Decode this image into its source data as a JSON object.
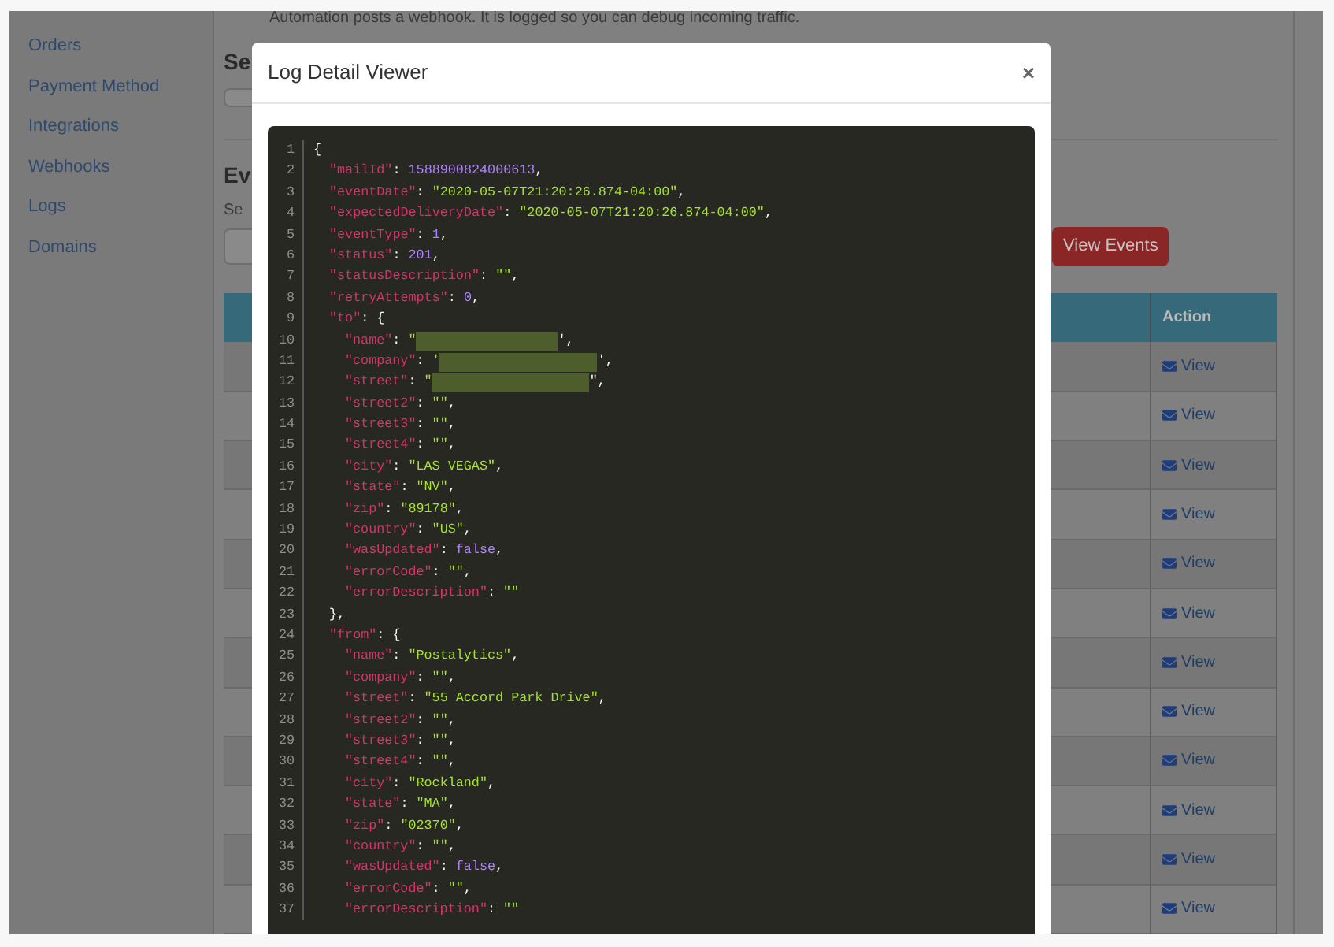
{
  "sidebar": {
    "items": [
      {
        "label": "Orders"
      },
      {
        "label": "Payment Method"
      },
      {
        "label": "Integrations"
      },
      {
        "label": "Webhooks"
      },
      {
        "label": "Logs"
      },
      {
        "label": "Domains"
      }
    ]
  },
  "intro_text": "Automation posts a webhook. It is logged so you can debug incoming traffic.",
  "section_1": {
    "heading": "Se"
  },
  "section_2": {
    "heading": "Ev",
    "label": "Se",
    "button": "View Events"
  },
  "table": {
    "columns": [
      {
        "label": "Action"
      }
    ],
    "rows": [
      {
        "action": "View"
      },
      {
        "action": "View"
      },
      {
        "action": "View"
      },
      {
        "action": "View"
      },
      {
        "action": "View"
      },
      {
        "action": "View"
      },
      {
        "action": "View"
      },
      {
        "action": "View"
      },
      {
        "action": "View"
      },
      {
        "action": "View"
      },
      {
        "action": "View"
      },
      {
        "action": "View"
      }
    ]
  },
  "modal": {
    "title": "Log Detail Viewer",
    "close": "×",
    "lines": [
      {
        "n": "1",
        "value": "{",
        "kind": "punct",
        "children": [
          {
            "n": "2",
            "key": "\"mailId\"",
            "sep": ": ",
            "value": "1588900824000613",
            "kind": "number",
            "end": ","
          },
          {
            "n": "3",
            "key": "\"eventDate\"",
            "sep": ": ",
            "value": "\"2020-05-07T21:20:26.874-04:00\"",
            "kind": "string",
            "end": ","
          },
          {
            "n": "4",
            "key": "\"expectedDeliveryDate\"",
            "sep": ": ",
            "value": "\"2020-05-07T21:20:26.874-04:00\"",
            "kind": "string",
            "end": ","
          },
          {
            "n": "5",
            "key": "\"eventType\"",
            "sep": ": ",
            "value": "1",
            "kind": "number",
            "end": ","
          },
          {
            "n": "6",
            "key": "\"status\"",
            "sep": ": ",
            "value": "201",
            "kind": "number",
            "end": ","
          },
          {
            "n": "7",
            "key": "\"statusDescription\"",
            "sep": ": ",
            "value": "\"\"",
            "kind": "string",
            "end": ","
          },
          {
            "n": "8",
            "key": "\"retryAttempts\"",
            "sep": ": ",
            "value": "0",
            "kind": "number",
            "end": ","
          },
          {
            "n": "9",
            "key": "\"to\"",
            "sep": ": ",
            "value": "{",
            "kind": "punct",
            "children": [
              {
                "n": "10",
                "key": "\"name\"",
                "sep": ": ",
                "value": "\"",
                "kind": "redacted",
                "end": "',"
              },
              {
                "n": "11",
                "key": "\"company\"",
                "sep": ": ",
                "value": "'",
                "kind": "redacted",
                "end": "',"
              },
              {
                "n": "12",
                "key": "\"street\"",
                "sep": ": ",
                "value": "\"",
                "kind": "redacted",
                "end": "\","
              },
              {
                "n": "13",
                "key": "\"street2\"",
                "sep": ": ",
                "value": "\"\"",
                "kind": "string",
                "end": ","
              },
              {
                "n": "14",
                "key": "\"street3\"",
                "sep": ": ",
                "value": "\"\"",
                "kind": "string",
                "end": ","
              },
              {
                "n": "15",
                "key": "\"street4\"",
                "sep": ": ",
                "value": "\"\"",
                "kind": "string",
                "end": ","
              },
              {
                "n": "16",
                "key": "\"city\"",
                "sep": ": ",
                "value": "\"LAS VEGAS\"",
                "kind": "string",
                "end": ","
              },
              {
                "n": "17",
                "key": "\"state\"",
                "sep": ": ",
                "value": "\"NV\"",
                "kind": "string",
                "end": ","
              },
              {
                "n": "18",
                "key": "\"zip\"",
                "sep": ": ",
                "value": "\"89178\"",
                "kind": "string",
                "end": ","
              },
              {
                "n": "19",
                "key": "\"country\"",
                "sep": ": ",
                "value": "\"US\"",
                "kind": "string",
                "end": ","
              },
              {
                "n": "20",
                "key": "\"wasUpdated\"",
                "sep": ": ",
                "value": "false",
                "kind": "number",
                "end": ","
              },
              {
                "n": "21",
                "key": "\"errorCode\"",
                "sep": ": ",
                "value": "\"\"",
                "kind": "string",
                "end": ","
              },
              {
                "n": "22",
                "key": "\"errorDescription\"",
                "sep": ": ",
                "value": "\"\"",
                "kind": "string"
              }
            ]
          },
          {
            "n": "23",
            "value": "},",
            "kind": "punct"
          },
          {
            "n": "24",
            "key": "\"from\"",
            "sep": ": ",
            "value": "{",
            "kind": "punct",
            "children": [
              {
                "n": "25",
                "key": "\"name\"",
                "sep": ": ",
                "value": "\"Postalytics\"",
                "kind": "string",
                "end": ","
              },
              {
                "n": "26",
                "key": "\"company\"",
                "sep": ": ",
                "value": "\"\"",
                "kind": "string",
                "end": ","
              },
              {
                "n": "27",
                "key": "\"street\"",
                "sep": ": ",
                "value": "\"55 Accord Park Drive\"",
                "kind": "string",
                "end": ","
              },
              {
                "n": "28",
                "key": "\"street2\"",
                "sep": ": ",
                "value": "\"\"",
                "kind": "string",
                "end": ","
              },
              {
                "n": "29",
                "key": "\"street3\"",
                "sep": ": ",
                "value": "\"\"",
                "kind": "string",
                "end": ","
              },
              {
                "n": "30",
                "key": "\"street4\"",
                "sep": ": ",
                "value": "\"\"",
                "kind": "string",
                "end": ","
              },
              {
                "n": "31",
                "key": "\"city\"",
                "sep": ": ",
                "value": "\"Rockland\"",
                "kind": "string",
                "end": ","
              },
              {
                "n": "32",
                "key": "\"state\"",
                "sep": ": ",
                "value": "\"MA\"",
                "kind": "string",
                "end": ","
              },
              {
                "n": "33",
                "key": "\"zip\"",
                "sep": ": ",
                "value": "\"02370\"",
                "kind": "string",
                "end": ","
              },
              {
                "n": "34",
                "key": "\"country\"",
                "sep": ": ",
                "value": "\"\"",
                "kind": "string",
                "end": ","
              },
              {
                "n": "35",
                "key": "\"wasUpdated\"",
                "sep": ": ",
                "value": "false",
                "kind": "number",
                "end": ","
              },
              {
                "n": "36",
                "key": "\"errorCode\"",
                "sep": ": ",
                "value": "\"\"",
                "kind": "string",
                "end": ","
              },
              {
                "n": "37",
                "key": "\"errorDescription\"",
                "sep": ": ",
                "value": "\"\"",
                "kind": "string"
              }
            ]
          }
        ]
      }
    ]
  }
}
